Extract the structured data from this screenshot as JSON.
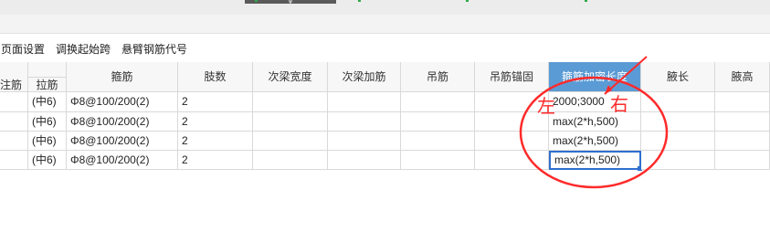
{
  "toolbar": {
    "page_setup": "页面设置",
    "swap_start_span": "调换起始跨",
    "cantilever_code": "悬臂钢筋代号"
  },
  "header": {
    "note_bar": "注筋",
    "tie_bar": "拉筋",
    "stirrup": "箍筋",
    "legs": "肢数",
    "secondary_beam_width": "次梁宽度",
    "secondary_beam_bar": "次梁加筋",
    "hanger_bar": "吊筋",
    "hanger_anchor": "吊筋锚固",
    "stirrup_dense_length": "箍筋加密长度",
    "haunch_length": "腋长",
    "haunch_height": "腋高"
  },
  "rows": [
    {
      "tie": "(中6)",
      "stirrup": "8@100/200(2)",
      "legs": "2",
      "dense_length": "2000;3000"
    },
    {
      "tie": "(中6)",
      "stirrup": "8@100/200(2)",
      "legs": "2",
      "dense_length": "max(2*h,500)"
    },
    {
      "tie": "(中6)",
      "stirrup": "8@100/200(2)",
      "legs": "2",
      "dense_length": "max(2*h,500)"
    },
    {
      "tie": "(中6)",
      "stirrup": "8@100/200(2)",
      "legs": "2",
      "dense_length": "max(2*h,500)"
    }
  ],
  "stirrup_symbol": "Φ",
  "annotations": {
    "left": "左",
    "right": "右"
  },
  "colors": {
    "selected_header": "#5b9bd5",
    "selection_border": "#2f6fce",
    "annotation": "#ff2a2a"
  }
}
